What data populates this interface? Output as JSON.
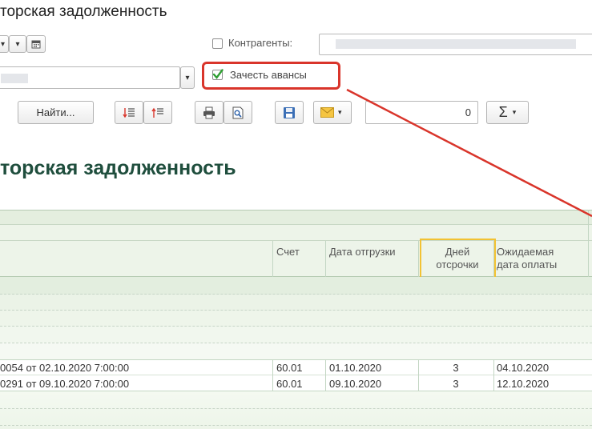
{
  "window": {
    "title": "торская задолженность"
  },
  "filters": {
    "counterparties_label": "Контрагенты:",
    "offset_advances_label": "Зачесть авансы",
    "offset_advances_checked": true
  },
  "toolbar": {
    "find_label": "Найти...",
    "number_value": "0",
    "sum_label": "Σ"
  },
  "report": {
    "title": "торская задолженность",
    "columns": {
      "account": "Счет",
      "ship_date": "Дата отгрузки",
      "days_deferral_1": "Дней",
      "days_deferral_2": "отсрочки",
      "expected_1": "Ожидаемая",
      "expected_2": "дата оплаты"
    },
    "rows": [
      {
        "doc": "0054 от 02.10.2020 7:00:00",
        "account": "60.01",
        "ship_date": "01.10.2020",
        "days": "3",
        "expected": "04.10.2020"
      },
      {
        "doc": "0291 от 09.10.2020 7:00:00",
        "account": "60.01",
        "ship_date": "09.10.2020",
        "days": "3",
        "expected": "12.10.2020"
      }
    ]
  },
  "annotation": {
    "highlight_color": "#d9352b",
    "column_highlight_color": "#f2c233"
  }
}
